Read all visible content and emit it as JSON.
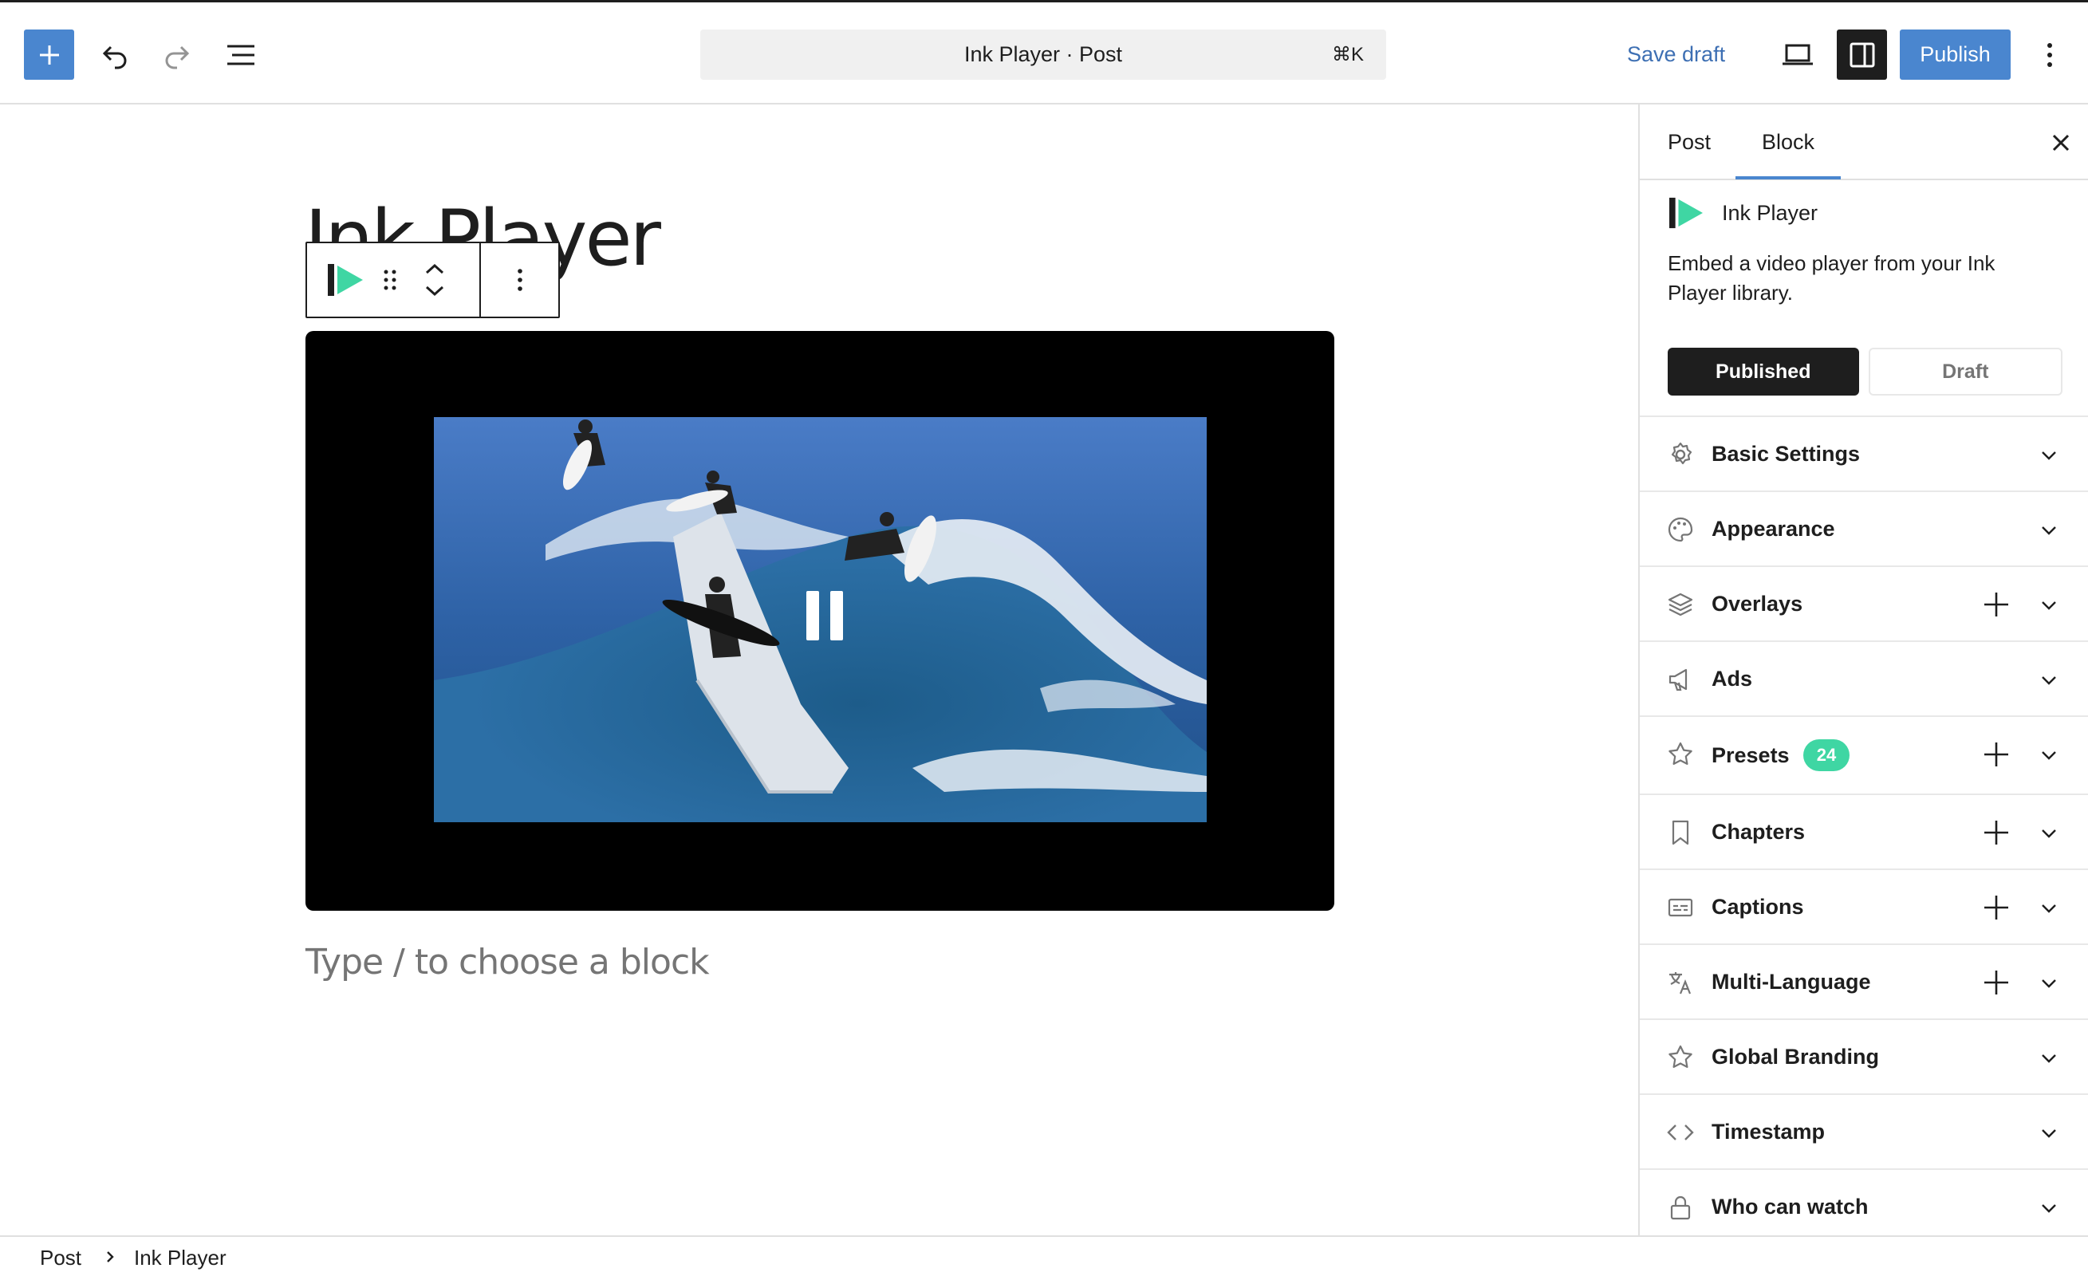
{
  "toolbar": {
    "document_title": "Ink Player · Post",
    "shortcut": "⌘K",
    "save_draft_label": "Save draft",
    "publish_label": "Publish"
  },
  "canvas": {
    "post_title": "Ink Player",
    "appender_placeholder": "Type / to choose a block"
  },
  "sidebar": {
    "tabs": [
      {
        "label": "Post"
      },
      {
        "label": "Block",
        "active": true
      }
    ],
    "block": {
      "name": "Ink Player",
      "description": "Embed a video player from your Ink Player library."
    },
    "status_toggle": {
      "options": [
        "Published",
        "Draft"
      ],
      "selected": "Published"
    },
    "panels": [
      {
        "label": "Basic Settings",
        "icon": "gear-icon"
      },
      {
        "label": "Appearance",
        "icon": "palette-icon"
      },
      {
        "label": "Overlays",
        "icon": "layers-icon",
        "addable": true
      },
      {
        "label": "Ads",
        "icon": "megaphone-icon"
      },
      {
        "label": "Presets",
        "icon": "star-icon",
        "badge": "24",
        "addable": true
      },
      {
        "label": "Chapters",
        "icon": "bookmark-icon",
        "addable": true
      },
      {
        "label": "Captions",
        "icon": "captions-icon",
        "addable": true
      },
      {
        "label": "Multi-Language",
        "icon": "translate-icon",
        "addable": true
      },
      {
        "label": "Global Branding",
        "icon": "star-icon"
      },
      {
        "label": "Timestamp",
        "icon": "code-icon"
      },
      {
        "label": "Who can watch",
        "icon": "lock-icon"
      }
    ]
  },
  "breadcrumb": {
    "items": [
      "Post",
      "Ink Player"
    ]
  },
  "colors": {
    "accent": "#4a86cf",
    "brand_green": "#3fd6a3",
    "dark": "#1e1e1e"
  }
}
